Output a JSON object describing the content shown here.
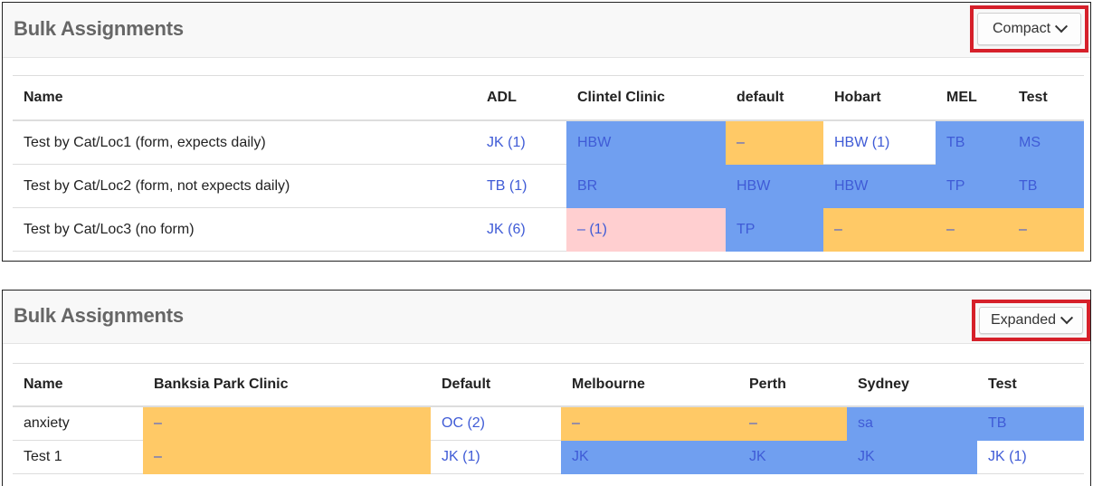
{
  "compact_panel": {
    "title": "Bulk Assignments",
    "mode_label": "Compact",
    "columns": [
      "Name",
      "ADL",
      "Clintel Clinic",
      "default",
      "Hobart",
      "MEL",
      "Test"
    ],
    "rows": [
      {
        "name": "Test by Cat/Loc1 (form, expects daily)",
        "cells": [
          "JK (1)",
          "HBW",
          "–",
          "HBW (1)",
          "TB",
          "MS"
        ]
      },
      {
        "name": "Test by Cat/Loc2 (form, not expects daily)",
        "cells": [
          "TB (1)",
          "BR",
          "HBW",
          "HBW",
          "TP",
          "TB"
        ]
      },
      {
        "name": "Test by Cat/Loc3 (no form)",
        "cells": [
          "JK (6)",
          "– (1)",
          "TP",
          "–",
          "–",
          "–"
        ]
      }
    ]
  },
  "expanded_panel": {
    "title": "Bulk Assignments",
    "mode_label": "Expanded",
    "columns": [
      "Name",
      "Banksia Park Clinic",
      "Default",
      "Melbourne",
      "Perth",
      "Sydney",
      "Test"
    ],
    "rows": [
      {
        "name": "anxiety",
        "cells": [
          "–",
          "OC (2)",
          "–",
          "–",
          "sa",
          "TB"
        ]
      },
      {
        "name": "Test 1",
        "cells": [
          "–",
          "JK (1)",
          "JK",
          "JK",
          "JK",
          "JK (1)"
        ]
      }
    ]
  },
  "colors": {
    "assigned_blue": "#709ff0",
    "unassigned_orange": "#ffc966",
    "partial_pink": "#ffcfd0",
    "link_text": "#3f5bd6",
    "highlight_red": "#d6202a"
  }
}
